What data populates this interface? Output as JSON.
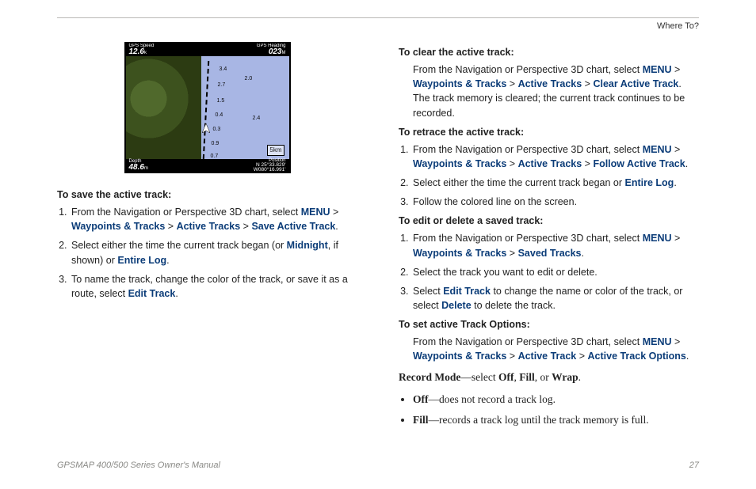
{
  "section_label": "Where To?",
  "gps_panel": {
    "top_left_label": "GPS Speed",
    "top_left_value": "12.6",
    "top_left_unit": "k",
    "top_right_label": "GPS Heading",
    "top_right_value": "023",
    "top_right_unit": "M",
    "bottom_left_label": "Depth",
    "bottom_left_value": "48.6",
    "bottom_left_unit": "m",
    "bottom_right_label": "Position",
    "bottom_right_lat": "N  25°33.829'",
    "bottom_right_lon": "W080°16.991'",
    "scale": "5km",
    "depth_numbers": [
      "3.4",
      "2.7",
      "1.5",
      "0.4",
      "0.3",
      "0.9",
      "0.7",
      "2.0",
      "2.4"
    ]
  },
  "left": {
    "save": {
      "heading": "To save the active track:",
      "step1_pre": "From the Navigation or Perspective 3D chart, select ",
      "step1_menu": "MENU",
      "step1_wp": "Waypoints & Tracks",
      "step1_at": "Active Tracks",
      "step1_sat": "Save Active Track",
      "step2_pre": "Select either the time the current track began (or ",
      "step2_mid_kw": "Midnight",
      "step2_mid": ", if shown) or ",
      "step2_entire": "Entire Log",
      "step3_pre": "To name the track, change the color of the track, or save it as a route, select ",
      "step3_kw": "Edit Track"
    }
  },
  "right": {
    "clear": {
      "heading": "To clear the active track:",
      "line_pre": "From the Navigation or Perspective 3D chart, select ",
      "menu": "MENU",
      "wp": "Waypoints & Tracks",
      "at": "Active Tracks",
      "cat": "Clear Active Track",
      "tail": ". The track memory is cleared; the current track continues to be recorded."
    },
    "retrace": {
      "heading": "To retrace the active track:",
      "s1_pre": "From the Navigation or Perspective 3D chart, select ",
      "menu": "MENU",
      "wp": "Waypoints & Tracks",
      "at": "Active Tracks",
      "fat": "Follow Active Track",
      "s2_pre": "Select either the time the current track began or ",
      "s2_kw": "Entire Log",
      "s3": "Follow the colored line on the screen."
    },
    "edit": {
      "heading": "To edit or delete a saved track:",
      "s1_pre": "From the Navigation or Perspective 3D chart, select ",
      "menu": "MENU",
      "wp": "Waypoints & Tracks",
      "st": "Saved Tracks",
      "s2": "Select the track you want to edit or delete.",
      "s3_pre": "Select ",
      "s3_kw1": "Edit Track",
      "s3_mid": " to change the name or color of the track, or select ",
      "s3_kw2": "Delete",
      "s3_tail": " to delete the track."
    },
    "options": {
      "heading": "To set active Track Options:",
      "line_pre": "From the Navigation or Perspective 3D chart, select ",
      "menu": "MENU",
      "wp": "Waypoints & Tracks",
      "at": "Active Track",
      "ato": "Active Track Options"
    },
    "record_mode": {
      "label": "Record Mode",
      "sep": "—select ",
      "off": "Off",
      "fill": "Fill",
      "or": ", or ",
      "wrap": "Wrap",
      "off_desc": "—does not record a track log.",
      "fill_desc": "—records a track log until the track memory is full."
    }
  },
  "footer": {
    "manual": "GPSMAP 400/500 Series Owner's Manual",
    "page": "27"
  },
  "glyphs": {
    "gt": " > ",
    "period": ".",
    "comma_sp": ", "
  }
}
